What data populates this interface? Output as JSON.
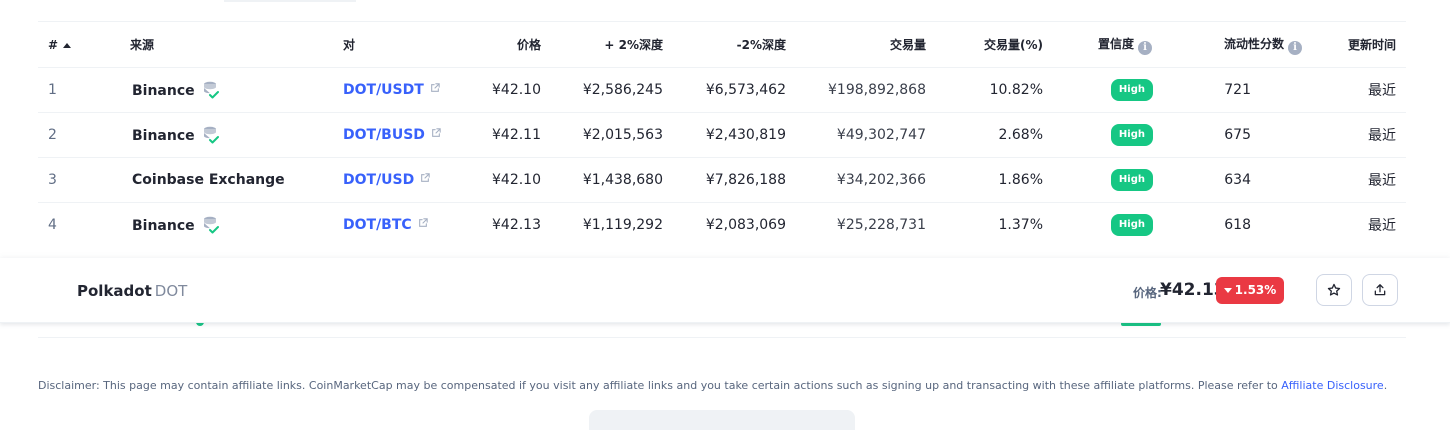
{
  "table": {
    "headers": {
      "rank": "#",
      "source": "来源",
      "pair": "对",
      "price": "价格",
      "depth_plus": "+ 2%深度",
      "depth_minus": "-2%深度",
      "volume": "交易量",
      "volume_pct": "交易量(%)",
      "confidence": "置信度",
      "liquidity": "流动性分数",
      "updated": "更新时间"
    },
    "rows": [
      {
        "rank": "1",
        "source": "Binance",
        "verified": true,
        "pair": "DOT/USDT",
        "price": "¥42.10",
        "depth_plus": "¥2,586,245",
        "depth_minus": "¥6,573,462",
        "volume": "¥198,892,868",
        "volume_pct": "10.82%",
        "confidence": "High",
        "liquidity": "721",
        "updated": "最近"
      },
      {
        "rank": "2",
        "source": "Binance",
        "verified": true,
        "pair": "DOT/BUSD",
        "price": "¥42.11",
        "depth_plus": "¥2,015,563",
        "depth_minus": "¥2,430,819",
        "volume": "¥49,302,747",
        "volume_pct": "2.68%",
        "confidence": "High",
        "liquidity": "675",
        "updated": "最近"
      },
      {
        "rank": "3",
        "source": "Coinbase Exchange",
        "verified": false,
        "pair": "DOT/USD",
        "price": "¥42.10",
        "depth_plus": "¥1,438,680",
        "depth_minus": "¥7,826,188",
        "volume": "¥34,202,366",
        "volume_pct": "1.86%",
        "confidence": "High",
        "liquidity": "634",
        "updated": "最近"
      },
      {
        "rank": "4",
        "source": "Binance",
        "verified": true,
        "pair": "DOT/BTC",
        "price": "¥42.13",
        "depth_plus": "¥1,119,292",
        "depth_minus": "¥2,083,069",
        "volume": "¥25,228,731",
        "volume_pct": "1.37%",
        "confidence": "High",
        "liquidity": "618",
        "updated": "最近"
      }
    ]
  },
  "sticky_header": {
    "coin_name": "Polkadot",
    "coin_symbol": "DOT",
    "price_label": "价格:",
    "price": "¥42.13",
    "change": "1.53%",
    "star_icon": "star-icon",
    "share_icon": "share-icon"
  },
  "disclaimer": {
    "text": "Disclaimer: This page may contain affiliate links. CoinMarketCap may be compensated if you visit any affiliate links and you take certain actions such as signing up and transacting with these affiliate platforms. Please refer to ",
    "link": "Affiliate Disclosure",
    "end": "."
  },
  "colors": {
    "link": "#3861fb",
    "high_badge": "#16c784",
    "change_negative": "#ea3943",
    "muted": "#616e85"
  }
}
